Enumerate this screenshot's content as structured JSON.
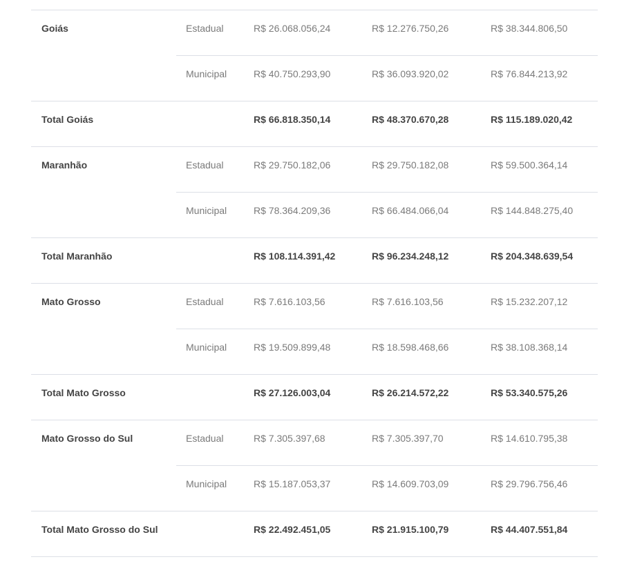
{
  "rows": [
    {
      "state": "Goiás",
      "estadual": {
        "label": "Estadual",
        "v1": "R$ 26.068.056,24",
        "v2": "R$ 12.276.750,26",
        "v3": "R$ 38.344.806,50"
      },
      "municipal": {
        "label": "Municipal",
        "v1": "R$ 40.750.293,90",
        "v2": "R$ 36.093.920,02",
        "v3": "R$ 76.844.213,92"
      },
      "total": {
        "label": "Total Goiás",
        "v1": "R$ 66.818.350,14",
        "v2": "R$ 48.370.670,28",
        "v3": "R$ 115.189.020,42"
      }
    },
    {
      "state": "Maranhão",
      "estadual": {
        "label": "Estadual",
        "v1": "R$ 29.750.182,06",
        "v2": "R$ 29.750.182,08",
        "v3": "R$ 59.500.364,14"
      },
      "municipal": {
        "label": "Municipal",
        "v1": "R$ 78.364.209,36",
        "v2": "R$ 66.484.066,04",
        "v3": "R$ 144.848.275,40"
      },
      "total": {
        "label": "Total Maranhão",
        "v1": "R$ 108.114.391,42",
        "v2": "R$ 96.234.248,12",
        "v3": "R$ 204.348.639,54"
      }
    },
    {
      "state": "Mato Grosso",
      "estadual": {
        "label": "Estadual",
        "v1": "R$ 7.616.103,56",
        "v2": "R$ 7.616.103,56",
        "v3": "R$ 15.232.207,12"
      },
      "municipal": {
        "label": "Municipal",
        "v1": "R$ 19.509.899,48",
        "v2": "R$ 18.598.468,66",
        "v3": "R$ 38.108.368,14"
      },
      "total": {
        "label": "Total Mato Grosso",
        "v1": "R$ 27.126.003,04",
        "v2": "R$ 26.214.572,22",
        "v3": "R$ 53.340.575,26"
      }
    },
    {
      "state": "Mato Grosso do Sul",
      "estadual": {
        "label": "Estadual",
        "v1": "R$ 7.305.397,68",
        "v2": "R$ 7.305.397,70",
        "v3": "R$ 14.610.795,38"
      },
      "municipal": {
        "label": "Municipal",
        "v1": "R$ 15.187.053,37",
        "v2": "R$ 14.609.703,09",
        "v3": "R$ 29.796.756,46"
      },
      "total": {
        "label": "Total Mato Grosso do Sul",
        "v1": "R$ 22.492.451,05",
        "v2": "R$ 21.915.100,79",
        "v3": "R$ 44.407.551,84"
      }
    }
  ]
}
